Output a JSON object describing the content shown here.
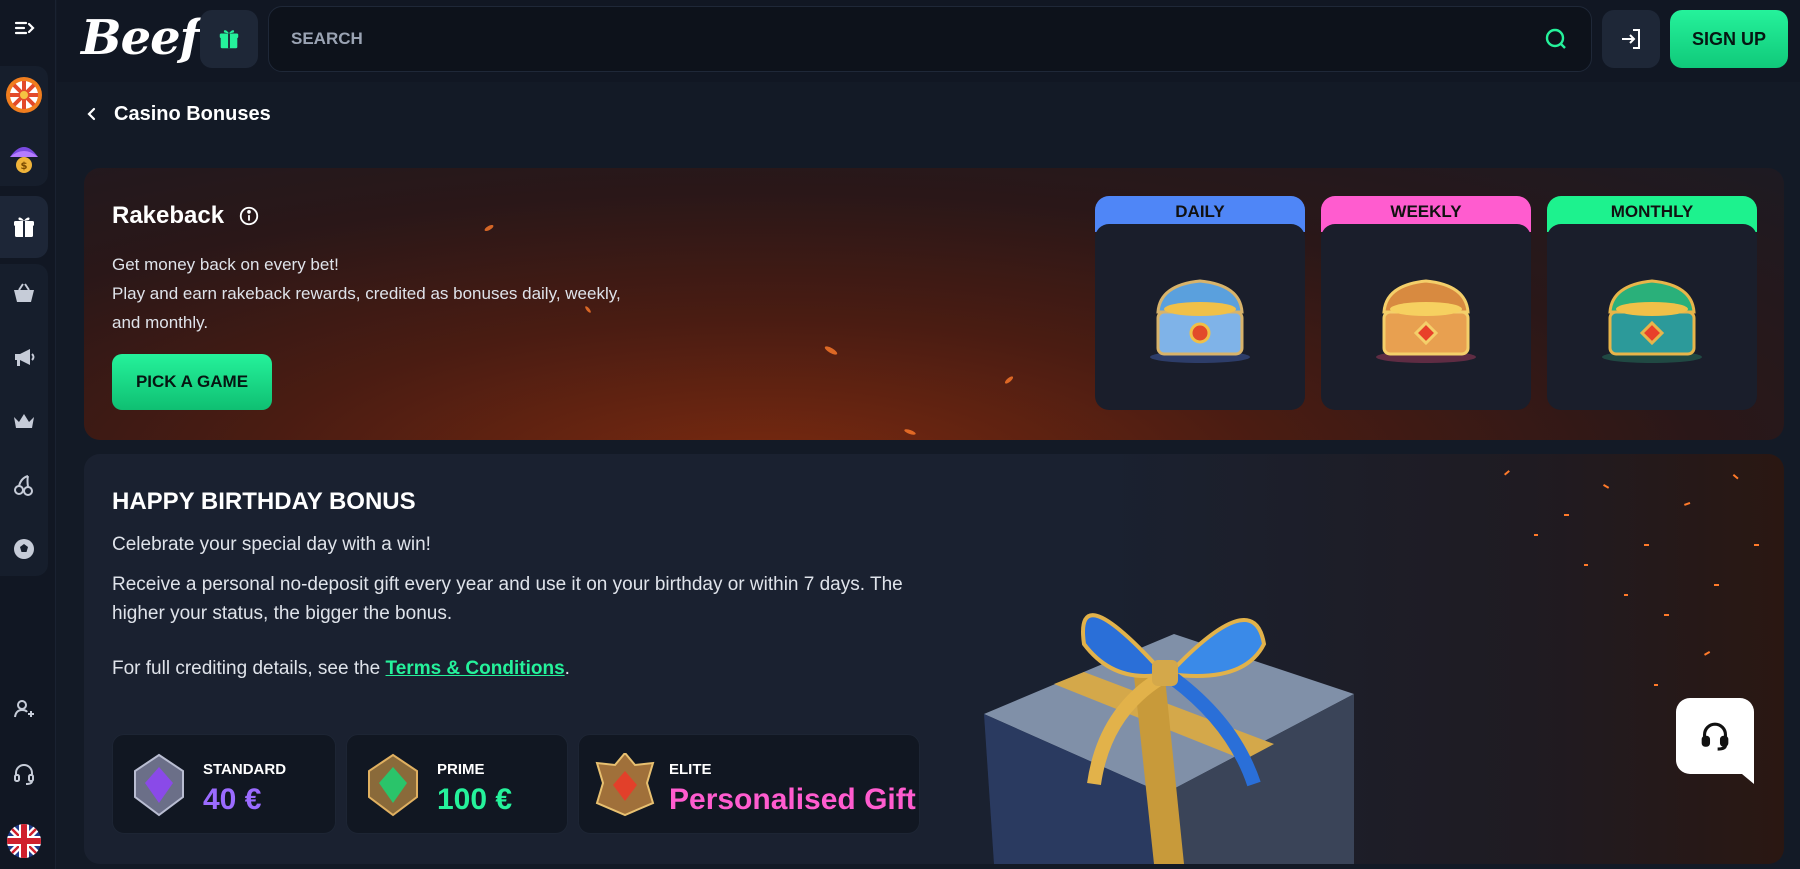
{
  "header": {
    "logo": "Beef",
    "search_placeholder": "SEARCH",
    "signup_label": "SIGN UP"
  },
  "breadcrumb": {
    "title": "Casino Bonuses"
  },
  "rakeback": {
    "title": "Rakeback",
    "desc_line1": "Get money back on every bet!",
    "desc_line2": "Play and earn rakeback rewards, credited as bonuses daily, weekly, and monthly.",
    "button": "PICK A GAME",
    "tiers": [
      {
        "label": "DAILY",
        "color": "#4f86f7"
      },
      {
        "label": "WEEKLY",
        "color": "#ff5ccf"
      },
      {
        "label": "MONTHLY",
        "color": "#1df28e"
      }
    ]
  },
  "birthday": {
    "title": "HAPPY BIRTHDAY BONUS",
    "subtitle": "Celebrate your special day with a win!",
    "desc": "Receive a personal no-deposit gift every year and use it on your birthday or within 7 days. The higher your status, the bigger the bonus.",
    "terms_prefix": "For full crediting details, see the ",
    "terms_link": "Terms & Conditions",
    "terms_suffix": ".",
    "statuses": [
      {
        "name": "STANDARD",
        "value": "40 €",
        "color": "#9b6bff"
      },
      {
        "name": "PRIME",
        "value": "100 €",
        "color": "#25f29b"
      },
      {
        "name": "ELITE",
        "value": "Personalised Gift",
        "color": "#ff5ccf"
      }
    ]
  },
  "sidebar": {
    "icons": [
      "menu-toggle-icon",
      "wheel-icon",
      "bonus-drop-icon",
      "gift-icon",
      "shop-basket-icon",
      "megaphone-icon",
      "crown-icon",
      "cherries-icon",
      "football-icon",
      "add-user-icon",
      "headset-icon",
      "uk-flag-icon"
    ]
  }
}
